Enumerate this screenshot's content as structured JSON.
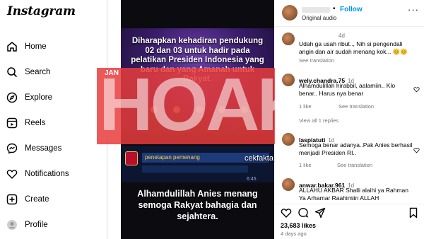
{
  "app": {
    "logo": "Instagram"
  },
  "sidebar": {
    "items": [
      {
        "label": "Home",
        "icon": "home-icon"
      },
      {
        "label": "Search",
        "icon": "search-icon"
      },
      {
        "label": "Explore",
        "icon": "compass-icon"
      },
      {
        "label": "Reels",
        "icon": "reels-icon"
      },
      {
        "label": "Messages",
        "icon": "messenger-icon"
      },
      {
        "label": "Notifications",
        "icon": "heart-icon"
      },
      {
        "label": "Create",
        "icon": "plus-square-icon"
      },
      {
        "label": "Profile",
        "icon": "avatar"
      }
    ]
  },
  "post": {
    "announcement": "Diharapkan kehadiran pendukung 02 dan 03 untuk hadir pada pelatikan Presiden Indonesia yang baru dan yang Amanah untuk Rakyat.",
    "caption": "Alhamdulillah Anies menang semoga Rakyat bahagia dan sejahtera.",
    "ticker": "penetapan pemenang",
    "time_chip": "6:45"
  },
  "stamp": {
    "word": "HOAKS",
    "tag": "JAN",
    "watermark": "cekfakta.tempo.co"
  },
  "header": {
    "follow": "Follow",
    "audio": "Original audio"
  },
  "comments": [
    {
      "user": "",
      "time": "4d",
      "text": "Udah ga usah ribut.., Nih si pengendali angin dan air sudah menang kok... 😊😊",
      "meta": "See translation"
    },
    {
      "user": "wely.chandra.75",
      "time": "1d",
      "text": "Alhamdulillah hirabbil, aalamiin.. Klo benar.. Harus nya benar",
      "meta_left": "1 like",
      "meta": "See translation",
      "replies": "View all 1 replies"
    },
    {
      "user": "laspiatuti",
      "time": "1d",
      "text": "Semoga benar adanya..Pak Anies berhasil menjadi Presiden RI..",
      "meta_left": "1 like",
      "meta": "See translation"
    },
    {
      "user": "anwar.bakar.961",
      "time": "1d",
      "text": "ALLAHU AKBAR Shalli alaihi ya Rahman Ya Arhamar Raahimiin ALLAH"
    }
  ],
  "footer": {
    "likes": "23,683 likes",
    "ago": "4 days ago"
  },
  "colors": {
    "accent": "#0095f6",
    "stamp": "#e83c3c",
    "muted": "#737373"
  }
}
